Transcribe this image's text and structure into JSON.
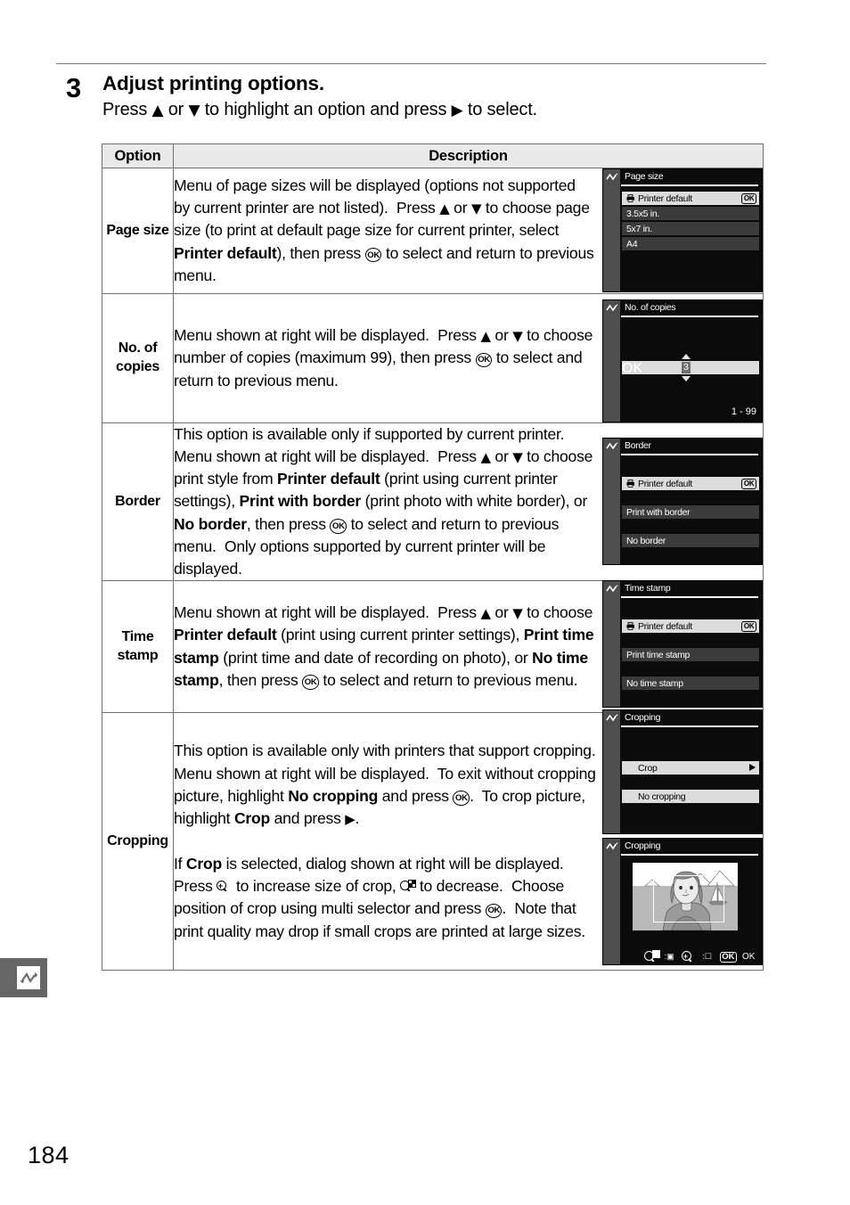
{
  "step": {
    "number": "3",
    "title": "Adjust printing options.",
    "instruction_before": "Press ",
    "instruction_mid1": " or ",
    "instruction_mid2": " to highlight an option and press ",
    "instruction_after": " to select.",
    "up_arrow": "▲",
    "down_arrow": "▼",
    "right_arrow": "▶"
  },
  "table": {
    "headers": {
      "option": "Option",
      "description": "Description"
    },
    "rows": [
      {
        "option": "Page size",
        "paragraphs": [
          "Menu of page sizes will be displayed (options not supported by current printer are not listed).  Press ▲ or ▼ to choose page size (to print at default page size for current printer, select Printer default), then press ⒪ to select and return to previous menu."
        ]
      },
      {
        "option": "No.  of copies",
        "paragraphs": [
          "Menu shown at right will be displayed.  Press ▲ or ▼ to choose number of copies (maximum 99), then press ⒪ to select and return to previous menu."
        ]
      },
      {
        "option": "Border",
        "paragraphs": [
          "This option is available only if supported by current printer.  Menu shown at right will be displayed.  Press ▲ or ▼ to choose print style from Printer default (print using current printer settings), Print with border (print photo with white border), or No border, then press ⒪ to select and return to previous menu.  Only options supported by current printer will be displayed."
        ]
      },
      {
        "option": "Time stamp",
        "paragraphs": [
          "Menu shown at right will be displayed.  Press ▲ or ▼ to choose Printer default (print using current printer settings), Print time stamp (print time and date of recording on photo), or No time stamp, then press ⒪ to select and return to previous menu."
        ]
      },
      {
        "option": "Cropping",
        "paragraphs": [
          "This option is available only with printers that support cropping.  Menu shown at right will be displayed.  To exit without cropping picture, highlight No cropping and press ⒪.  To crop picture, highlight Crop and press ▶.",
          "If Crop is selected, dialog shown at right will be displayed.  Press [zoom-in] to increase size of crop, [zoom-out] to decrease.  Choose position of crop using multi selector and press ⒪.  Note that print quality may drop if small crops are printed at large sizes."
        ]
      }
    ]
  },
  "screens": [
    {
      "id": "page-size",
      "title": "Page size",
      "items": [
        {
          "label": "Printer default",
          "selected": true,
          "printer_glyph": true,
          "ok_badge": "OK"
        },
        {
          "label": "3.5x5 in.",
          "selected": false
        },
        {
          "label": "5x7 in.",
          "selected": false
        },
        {
          "label": "A4",
          "selected": false
        }
      ]
    },
    {
      "id": "no-of-copies",
      "title": "No. of copies",
      "value": "3",
      "ok_badge": "OK",
      "range": "1 - 99"
    },
    {
      "id": "border",
      "title": "Border",
      "items": [
        {
          "label": "Printer default",
          "selected": true,
          "printer_glyph": true,
          "ok_badge": "OK"
        },
        {
          "label": "Print with border",
          "selected": false
        },
        {
          "label": "No border",
          "selected": false
        }
      ]
    },
    {
      "id": "time-stamp",
      "title": "Time stamp",
      "items": [
        {
          "label": "Printer default",
          "selected": true,
          "printer_glyph": true,
          "ok_badge": "OK"
        },
        {
          "label": "Print time stamp",
          "selected": false
        },
        {
          "label": "No time stamp",
          "selected": false
        }
      ]
    },
    {
      "id": "cropping-menu",
      "title": "Cropping",
      "items": [
        {
          "label": "Crop",
          "selected": true,
          "arrow": true
        },
        {
          "label": "No cropping",
          "selected": true
        }
      ]
    },
    {
      "id": "cropping-dialog",
      "title": "Cropping",
      "ok_label": "OK",
      "ok_badge": "OK"
    }
  ],
  "footer": {
    "page_number": "184"
  },
  "colors": {
    "header_fill": "#e9e9e9",
    "table_border": "#6f6f6f",
    "screen_bg": "#0b0b0b",
    "screen_sidebar": "#4e4e4e",
    "menu_row": "#3b3b3b",
    "menu_row_selected": "#dcdcdc",
    "side_tab": "#666666"
  }
}
